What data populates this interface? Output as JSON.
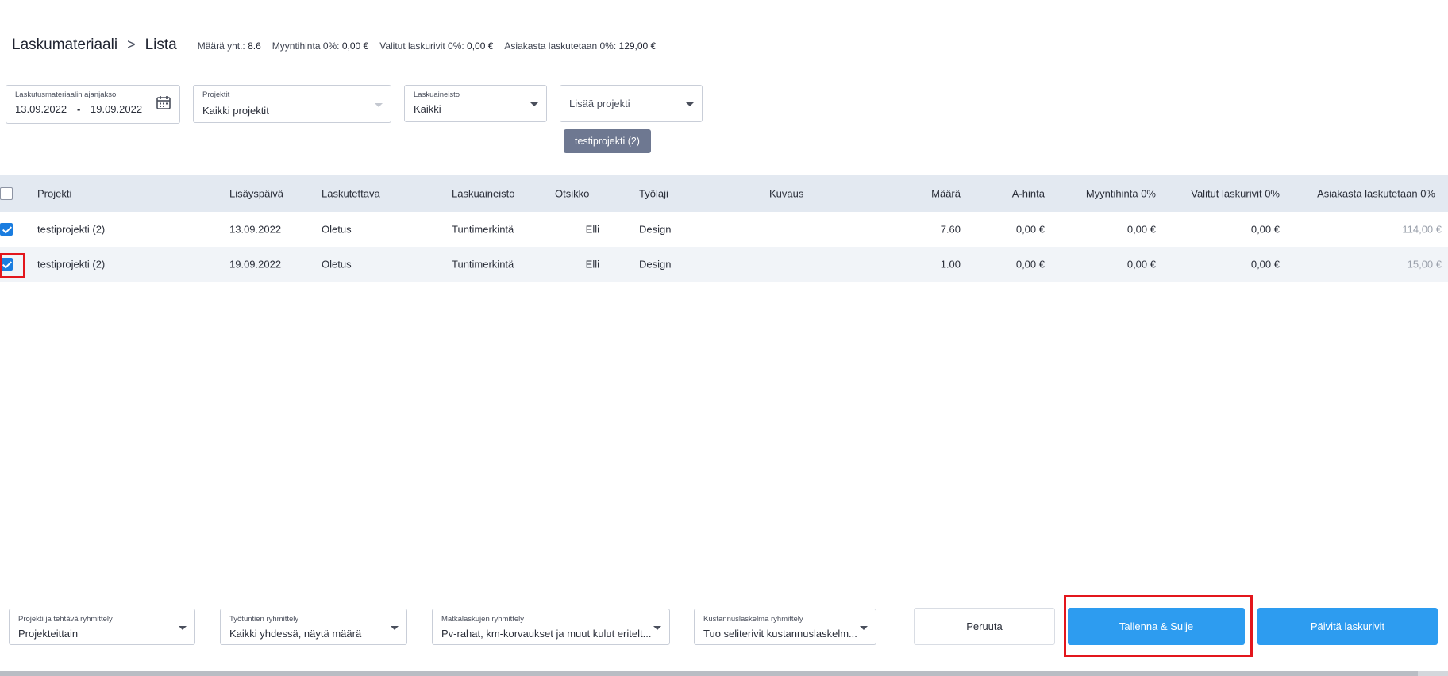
{
  "header": {
    "breadcrumb": [
      "Laskumateriaali",
      "Lista"
    ],
    "stats": [
      {
        "label": "Määrä yht.:",
        "value": "8.6"
      },
      {
        "label": "Myyntihinta 0%:",
        "value": "0,00 €"
      },
      {
        "label": "Valitut laskurivit 0%:",
        "value": "0,00 €"
      },
      {
        "label": "Asiakasta laskutetaan 0%:",
        "value": "129,00 €"
      }
    ]
  },
  "filters": {
    "period": {
      "label": "Laskutusmateriaalin ajanjakso",
      "start": "13.09.2022",
      "sep": "-",
      "end": "19.09.2022"
    },
    "projects": {
      "label": "Projektit",
      "value": "Kaikki projektit"
    },
    "invoice_material": {
      "label": "Laskuaineisto",
      "value": "Kaikki"
    },
    "add_project": {
      "placeholder": "Lisää projekti"
    },
    "chip": "testiprojekti (2)"
  },
  "table": {
    "columns": [
      "Projekti",
      "Lisäyspäivä",
      "Laskutettava",
      "Laskuaineisto",
      "Otsikko",
      "Työlaji",
      "Kuvaus",
      "Määrä",
      "A-hinta",
      "Myyntihinta 0%",
      "Valitut laskurivit 0%",
      "Asiakasta laskutetaan 0%"
    ],
    "rows": [
      {
        "checked": true,
        "project": "testiprojekti (2)",
        "date": "13.09.2022",
        "billable": "Oletus",
        "material": "Tuntimerkintä",
        "title": "Elli",
        "worktype": "Design",
        "description": "",
        "amount": "7.60",
        "unit_price": "0,00 €",
        "sales_price": "0,00 €",
        "selected": "0,00 €",
        "customer": "114,00 €"
      },
      {
        "checked": true,
        "project": "testiprojekti (2)",
        "date": "19.09.2022",
        "billable": "Oletus",
        "material": "Tuntimerkintä",
        "title": "Elli",
        "worktype": "Design",
        "description": "",
        "amount": "1.00",
        "unit_price": "0,00 €",
        "sales_price": "0,00 €",
        "selected": "0,00 €",
        "customer": "15,00 €"
      }
    ]
  },
  "footer": {
    "groupings": [
      {
        "label": "Projekti ja tehtävä ryhmittely",
        "value": "Projekteittain"
      },
      {
        "label": "Työtuntien ryhmittely",
        "value": "Kaikki yhdessä, näytä määrä"
      },
      {
        "label": "Matkalaskujen ryhmittely",
        "value": "Pv-rahat, km-korvaukset ja muut kulut eritelt..."
      },
      {
        "label": "Kustannuslaskelma ryhmittely",
        "value": "Tuo seliterivit kustannuslaskelm..."
      }
    ],
    "cancel": "Peruuta",
    "save_close": "Tallenna & Sulje",
    "update": "Päivitä laskurivit"
  },
  "colors": {
    "accent": "#2d9cf0",
    "highlight": "#e3161c",
    "header_bg": "#e3e9f1",
    "chip_bg": "#6e7891"
  }
}
